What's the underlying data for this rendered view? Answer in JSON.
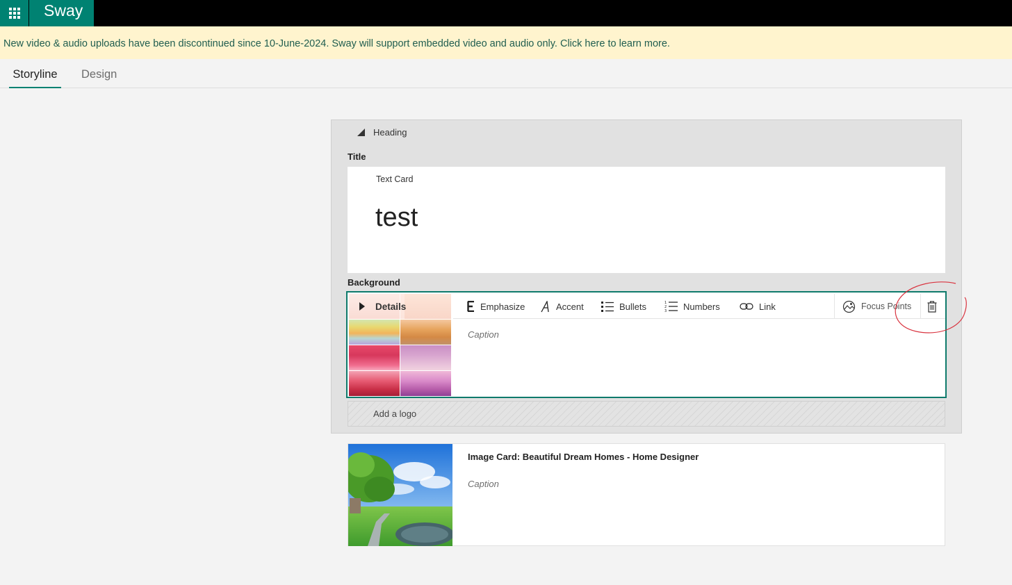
{
  "app": {
    "name": "Sway"
  },
  "notice": {
    "text": "New video & audio uploads have been discontinued since 10-June-2024. Sway will support embedded video and audio only. Click here to learn more."
  },
  "tabs": [
    {
      "label": "Storyline",
      "active": true
    },
    {
      "label": "Design",
      "active": false
    }
  ],
  "heading_group": {
    "label": "Heading",
    "title_section": "Title",
    "text_card": {
      "label": "Text Card",
      "value": "test"
    },
    "background_section": "Background",
    "background_card": {
      "details_label": "Details",
      "toolbar": {
        "emphasize": "Emphasize",
        "accent": "Accent",
        "bullets": "Bullets",
        "numbers": "Numbers",
        "link": "Link",
        "focus_points": "Focus Points"
      },
      "caption_placeholder": "Caption"
    },
    "logo_placeholder": "Add a logo"
  },
  "image_card": {
    "title": "Image Card: Beautiful Dream Homes - Home Designer",
    "caption_placeholder": "Caption"
  },
  "colors": {
    "brand": "#008272",
    "notice_bg": "#fff4ce",
    "selection_border": "#0e7a6b",
    "annotation": "#d9333f"
  },
  "icons": {
    "app_launcher": "waffle-icon",
    "collapse": "triangle-down-icon",
    "expand": "triangle-right-icon",
    "emphasize": "emphasize-icon",
    "accent": "accent-icon",
    "bullets": "bullet-list-icon",
    "numbers": "numbered-list-icon",
    "link": "link-icon",
    "focus_points": "focus-points-icon",
    "delete": "trash-icon"
  }
}
